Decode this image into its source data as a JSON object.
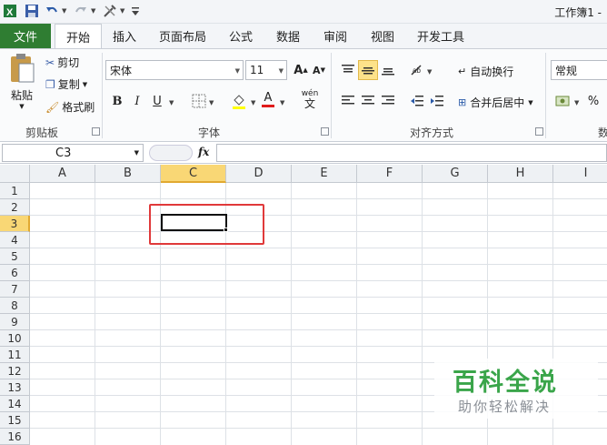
{
  "titlebar": {
    "app_title": "工作簿1 -"
  },
  "tabs": [
    "文件",
    "开始",
    "插入",
    "页面布局",
    "公式",
    "数据",
    "审阅",
    "视图",
    "开发工具"
  ],
  "clipboard": {
    "paste": "粘贴",
    "cut": "剪切",
    "copy": "复制",
    "format_painter": "格式刷",
    "group_label": "剪贴板"
  },
  "font": {
    "name": "宋体",
    "size": "11",
    "group_label": "字体",
    "bold": "B",
    "italic": "I",
    "underline": "U",
    "font_color_letter": "A",
    "grow": "A",
    "shrink": "A",
    "phonetic": "wén"
  },
  "alignment": {
    "wrap_text": "自动换行",
    "merge_center": "合并后居中",
    "group_label": "对齐方式"
  },
  "number": {
    "format": "常规",
    "percent": "%",
    "group_label": "数字"
  },
  "formula": {
    "name_box": "C3",
    "fx": "fx",
    "value": ""
  },
  "columns": [
    "A",
    "B",
    "C",
    "D",
    "E",
    "F",
    "G",
    "H",
    "I"
  ],
  "rows": [
    "1",
    "2",
    "3",
    "4",
    "5",
    "6",
    "7",
    "8",
    "9",
    "10",
    "11",
    "12",
    "13",
    "14",
    "15",
    "16"
  ],
  "selection": {
    "column": "C",
    "row": "3"
  },
  "watermark": {
    "title": "百科全说",
    "subtitle": "助你轻松解决"
  },
  "colors": {
    "file_tab": "#2f7d32",
    "selection_header": "#f9d775",
    "highlight": "#e0393a",
    "watermark": "#3aa54a"
  }
}
